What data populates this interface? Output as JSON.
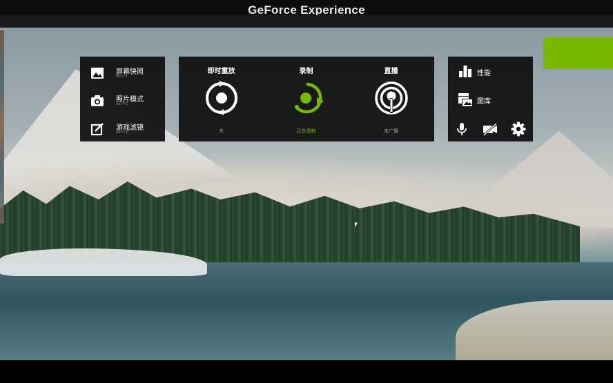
{
  "window": {
    "title": "GeForce Experience"
  },
  "quick_actions": [
    {
      "label": "屏幕快照",
      "hotkey": "Alt+F1",
      "icon": "image-icon"
    },
    {
      "label": "照片模式",
      "hotkey": "Alt+F2",
      "icon": "camera-icon"
    },
    {
      "label": "游戏滤镜",
      "hotkey": "Alt+F3",
      "icon": "filter-icon"
    }
  ],
  "features": [
    {
      "title": "即时重放",
      "status": "关",
      "icon": "instant-replay-icon",
      "state": "off"
    },
    {
      "title": "录制",
      "status": "正在录制",
      "icon": "record-icon",
      "state": "active"
    },
    {
      "title": "直播",
      "status": "未广播",
      "icon": "broadcast-icon",
      "state": "off"
    }
  ],
  "side_menu": [
    {
      "label": "性能",
      "icon": "performance-icon"
    },
    {
      "label": "图库",
      "icon": "gallery-icon"
    }
  ],
  "toolbar_icons": [
    "microphone-icon",
    "camera-off-icon",
    "gear-icon"
  ],
  "colors": {
    "accent": "#76b900",
    "panel": "#121212",
    "muted": "#9a9a9a"
  }
}
